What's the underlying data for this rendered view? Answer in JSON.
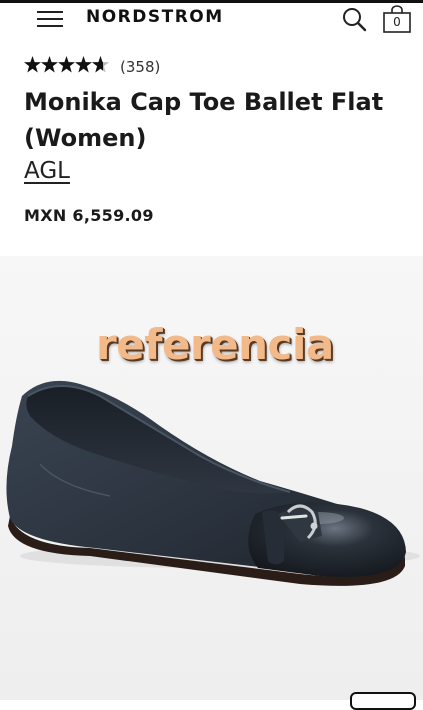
{
  "header": {
    "brand": "NORDSTROM",
    "bag_count": "0",
    "icons": [
      "hamburger-menu-icon",
      "search-icon",
      "shopping-bag-icon"
    ]
  },
  "product": {
    "stars": "★★★★★",
    "rating": 4.5,
    "review_count": "(358)",
    "title": "Monika Cap Toe Ballet Flat (Women)",
    "brand": "AGL",
    "price": "MXN 6,559.09"
  },
  "image": {
    "watermark": "referencia",
    "colors": {
      "shoe": "#2c3440",
      "patent_toe": "#1e242c",
      "background": "#f4f4f4"
    }
  }
}
